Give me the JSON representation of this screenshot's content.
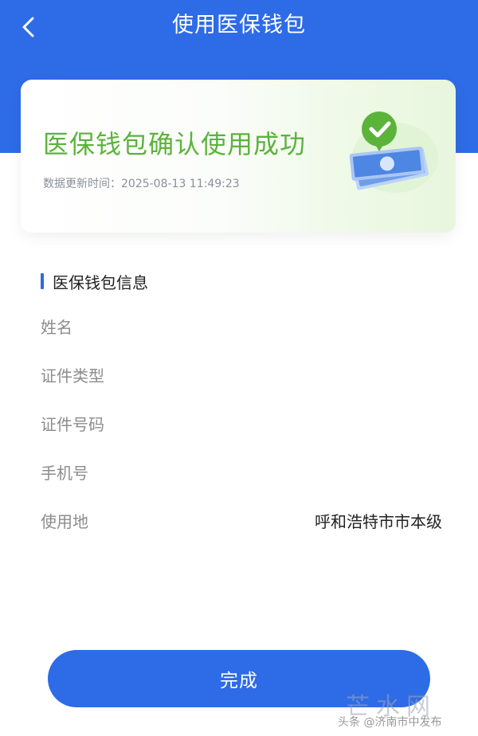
{
  "header": {
    "title": "使用医保钱包",
    "back_icon": "chevron-left-icon",
    "background_color": "#2e6be6"
  },
  "result": {
    "title": "医保钱包确认使用成功",
    "update_time": "数据更新时间：2025-08-13 11:49:23",
    "title_color": "#5bb33a",
    "illustration_icon": "wallet-success-icon"
  },
  "info_section": {
    "title": "医保钱包信息",
    "rows": [
      {
        "label": "姓名",
        "value": ""
      },
      {
        "label": "证件类型",
        "value": ""
      },
      {
        "label": "证件号码",
        "value": ""
      },
      {
        "label": "手机号",
        "value": ""
      },
      {
        "label": "使用地",
        "value": "呼和浩特市市本级"
      }
    ]
  },
  "footer": {
    "done_label": "完成"
  },
  "watermark": {
    "logo_text": "芒水网",
    "caption": "头条 @济南市中发布"
  }
}
